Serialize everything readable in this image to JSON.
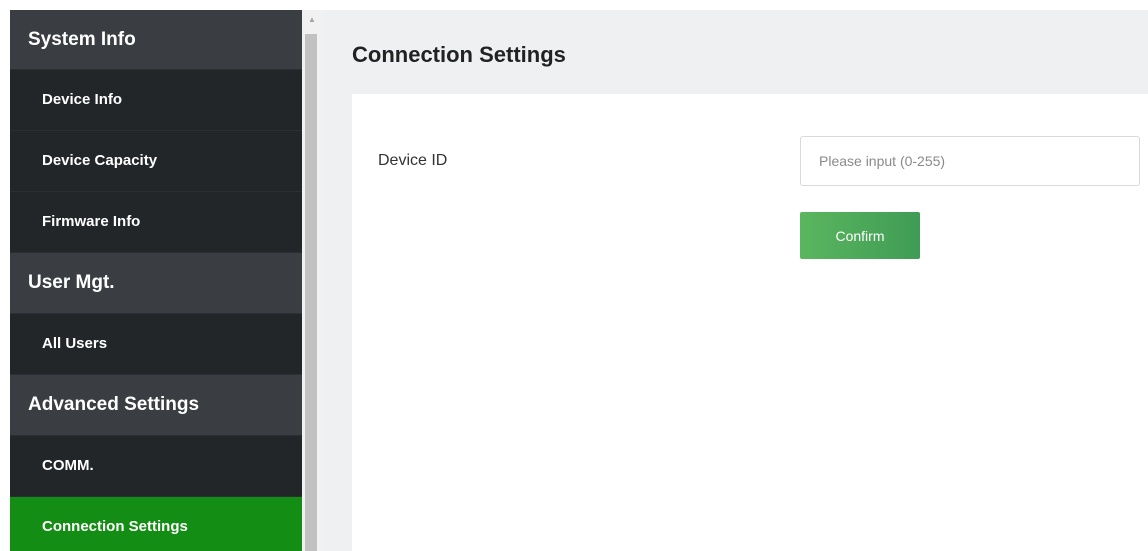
{
  "sidebar": {
    "sections": {
      "system_info": "System Info",
      "user_mgt": "User Mgt.",
      "advanced_settings": "Advanced Settings"
    },
    "items": {
      "device_info": "Device Info",
      "device_capacity": "Device Capacity",
      "firmware_info": "Firmware Info",
      "all_users": "All Users",
      "comm": "COMM.",
      "connection_settings": "Connection Settings"
    },
    "active_item": "connection_settings"
  },
  "scrollbar": {
    "up_arrow_icon": "triangle-up"
  },
  "main": {
    "title": "Connection Settings",
    "form": {
      "device_id_label": "Device ID",
      "device_id_value": "",
      "device_id_placeholder": "Please input (0-255)",
      "confirm_label": "Confirm"
    }
  },
  "colors": {
    "sidebar_section_bg": "#3a3e42",
    "sidebar_item_bg": "#222629",
    "sidebar_active_bg": "#148d14",
    "main_bg": "#eef0f1",
    "button_gradient_start": "#5ab65e",
    "button_gradient_end": "#3f9c55"
  }
}
